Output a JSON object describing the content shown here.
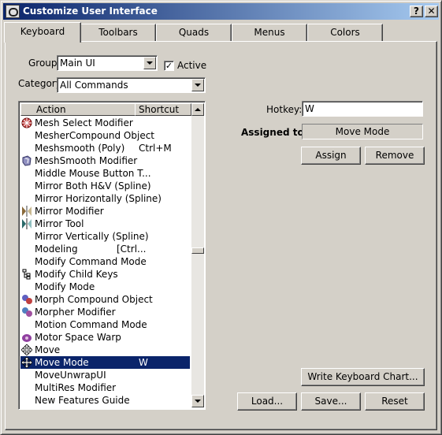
{
  "window": {
    "title": "Customize User Interface",
    "help_label": "?",
    "close_label": "✕"
  },
  "tabs": [
    {
      "label": "Keyboard",
      "active": true
    },
    {
      "label": "Toolbars"
    },
    {
      "label": "Quads"
    },
    {
      "label": "Menus"
    },
    {
      "label": "Colors"
    }
  ],
  "group": {
    "label": "Group:",
    "value": "Main UI"
  },
  "active_checkbox": {
    "label": "Active",
    "checked": true,
    "mark": "✓"
  },
  "category": {
    "label": "Category:",
    "value": "All Commands"
  },
  "list": {
    "headers": {
      "action": "Action",
      "shortcut": "Shortcut"
    },
    "rows": [
      {
        "action": "Mesh Select Modifier",
        "shortcut": "",
        "icon": "mesh-select-icon"
      },
      {
        "action": "MesherCompound Object",
        "shortcut": "",
        "icon": ""
      },
      {
        "action": "Meshsmooth (Poly)",
        "shortcut": "Ctrl+M",
        "icon": ""
      },
      {
        "action": "MeshSmooth Modifier",
        "shortcut": "",
        "icon": "meshsmooth-icon"
      },
      {
        "action": "Middle Mouse Button T...",
        "shortcut": "",
        "icon": ""
      },
      {
        "action": "Mirror Both H&V (Spline)",
        "shortcut": "",
        "icon": ""
      },
      {
        "action": "Mirror Horizontally (Spline)",
        "shortcut": "",
        "icon": ""
      },
      {
        "action": "Mirror Modifier",
        "shortcut": "",
        "icon": "mirror-modifier-icon"
      },
      {
        "action": "Mirror Tool",
        "shortcut": "",
        "icon": "mirror-tool-icon"
      },
      {
        "action": "Mirror Vertically (Spline)",
        "shortcut": "",
        "icon": ""
      },
      {
        "action": "Modeling",
        "shortcut": "[Ctrl...",
        "icon": ""
      },
      {
        "action": "Modify Command Mode",
        "shortcut": "",
        "icon": ""
      },
      {
        "action": "Modify Child Keys",
        "shortcut": "",
        "icon": "child-keys-icon"
      },
      {
        "action": "Modify Mode",
        "shortcut": "",
        "icon": ""
      },
      {
        "action": "Morph Compound Object",
        "shortcut": "",
        "icon": "morph-icon"
      },
      {
        "action": "Morpher Modifier",
        "shortcut": "",
        "icon": "morpher-icon"
      },
      {
        "action": "Motion Command Mode",
        "shortcut": "",
        "icon": ""
      },
      {
        "action": "Motor Space Warp",
        "shortcut": "",
        "icon": "motor-icon"
      },
      {
        "action": "Move",
        "shortcut": "",
        "icon": "move-icon"
      },
      {
        "action": "Move Mode",
        "shortcut": "W",
        "icon": "move-icon",
        "selected": true
      },
      {
        "action": "MoveUnwrapUI",
        "shortcut": "",
        "icon": ""
      },
      {
        "action": "MultiRes Modifier",
        "shortcut": "",
        "icon": ""
      },
      {
        "action": "New Features Guide",
        "shortcut": "",
        "icon": ""
      }
    ]
  },
  "hotkey": {
    "label": "Hotkey:",
    "value": "W"
  },
  "assigned_to": {
    "label": "Assigned to:",
    "value": "Move Mode"
  },
  "buttons": {
    "assign": "Assign",
    "remove": "Remove",
    "write_chart": "Write Keyboard Chart...",
    "load": "Load...",
    "save": "Save...",
    "reset": "Reset"
  }
}
